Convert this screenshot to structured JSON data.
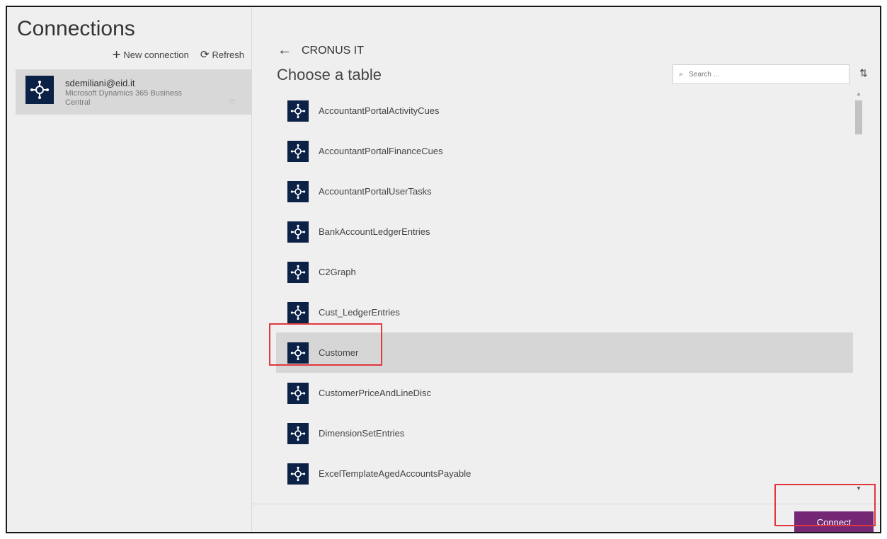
{
  "left": {
    "title": "Connections",
    "new_connection_label": "New connection",
    "refresh_label": "Refresh",
    "connection": {
      "user": "sdemiliani@eid.it",
      "description": "Microsoft Dynamics 365 Business Central"
    }
  },
  "right": {
    "breadcrumb": "CRONUS IT",
    "heading": "Choose a table",
    "search_placeholder": "Search ...",
    "tables": [
      {
        "name": "AccountantPortalActivityCues"
      },
      {
        "name": "AccountantPortalFinanceCues"
      },
      {
        "name": "AccountantPortalUserTasks"
      },
      {
        "name": "BankAccountLedgerEntries"
      },
      {
        "name": "C2Graph"
      },
      {
        "name": "Cust_LedgerEntries"
      },
      {
        "name": "Customer",
        "selected": true
      },
      {
        "name": "CustomerPriceAndLineDisc"
      },
      {
        "name": "DimensionSetEntries"
      },
      {
        "name": "ExcelTemplateAgedAccountsPayable"
      }
    ],
    "connect_label": "Connect"
  },
  "icons": {
    "back": "arrow-left-icon",
    "search": "search-icon",
    "sort": "sort-icon",
    "add": "plus-icon",
    "refresh": "refresh-icon",
    "table": "business-central-icon",
    "bulb": "lightbulb-icon"
  },
  "colors": {
    "connect_button": "#742774",
    "icon_background": "#0b2145",
    "selected_row": "#d6d6d6",
    "highlight": "#e0383e"
  }
}
